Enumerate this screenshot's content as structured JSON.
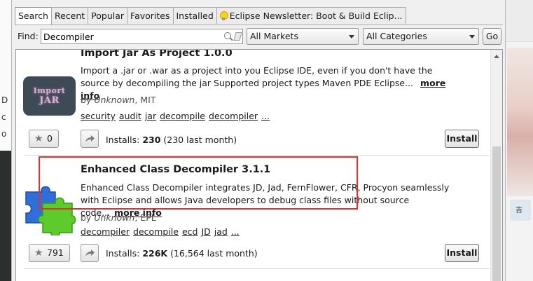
{
  "tabs": [
    "Search",
    "Recent",
    "Popular",
    "Favorites",
    "Installed",
    "Eclipse Newsletter: Boot & Build Eclip..."
  ],
  "find": {
    "label": "Find:",
    "value": "Decompiler",
    "markets": "All Markets",
    "categories": "All Categories",
    "go_label": "Go"
  },
  "entries": [
    {
      "title": "Import Jar As Project 1.0.0",
      "logo_text": [
        "Import",
        "JAR"
      ],
      "description": "Import a .jar or .war as a project into you Eclipse IDE, even if you don't have the source by decompiling the jar  Supported project types     Maven  PDE Eclipse...",
      "more_info": "more info",
      "by": "by",
      "author": "Unknown",
      "license": ", MIT",
      "tags": [
        "security",
        "audit",
        "jar",
        "decompile",
        "decompiler",
        "..."
      ],
      "favorites": "0",
      "installs_label": "Installs: ",
      "installs_total": "230",
      "installs_recent": " (230 last month)",
      "install_label": "Install"
    },
    {
      "title": "Enhanced Class Decompiler 3.1.1",
      "description": "Enhanced Class Decompiler integrates JD, Jad, FernFlower, CFR, Procyon seamlessly with Eclipse and allows Java developers to debug class files without source code...",
      "more_info": "more info",
      "by": "by",
      "author": "Unknown",
      "license": ", EPL",
      "tags": [
        "decompiler",
        "decompile",
        "ecd",
        "JD",
        "jad",
        "..."
      ],
      "favorites": "791",
      "installs_label": "Installs: ",
      "installs_total": "226K",
      "installs_recent": " (16,564 last month)",
      "install_label": "Install"
    }
  ],
  "background": {
    "left_glyphs": [
      "D",
      "c",
      "o"
    ],
    "right_badge": "吉"
  },
  "colors": {
    "highlight": "#e03030",
    "puzzle_blue": "#2f6fd8",
    "puzzle_green": "#5ccb2b"
  }
}
